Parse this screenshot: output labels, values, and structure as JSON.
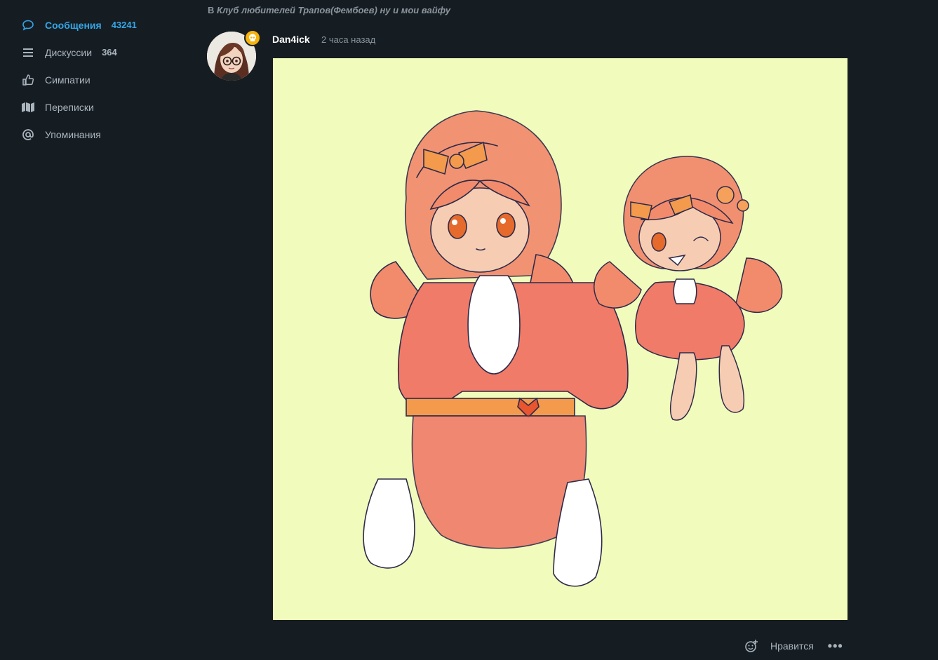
{
  "sidebar": {
    "items": [
      {
        "label": "Сообщения",
        "count": "43241",
        "icon": "chat-bubble-icon",
        "active": true
      },
      {
        "label": "Дискуссии",
        "count": "364",
        "icon": "list-icon",
        "active": false
      },
      {
        "label": "Симпатии",
        "count": "",
        "icon": "thumbs-up-icon",
        "active": false
      },
      {
        "label": "Переписки",
        "count": "",
        "icon": "map-icon",
        "active": false
      },
      {
        "label": "Упоминания",
        "count": "",
        "icon": "at-icon",
        "active": false
      }
    ]
  },
  "post": {
    "breadcrumb_prefix": "В",
    "breadcrumb_group": "Клуб любителей Трапов(Фембоев) ну и мои вайфу",
    "author": "Dan4ick",
    "timestamp": "2 часа назад",
    "badge_icon": "skull-icon"
  },
  "actions": {
    "react_icon": "add-reaction-icon",
    "like_label": "Нравится",
    "more_icon": "more-icon",
    "more_label": "•••"
  },
  "colors": {
    "background": "#161d22",
    "accent": "#33a6e8",
    "badge": "#f5b30b",
    "image_background": "#f1fbbb"
  }
}
